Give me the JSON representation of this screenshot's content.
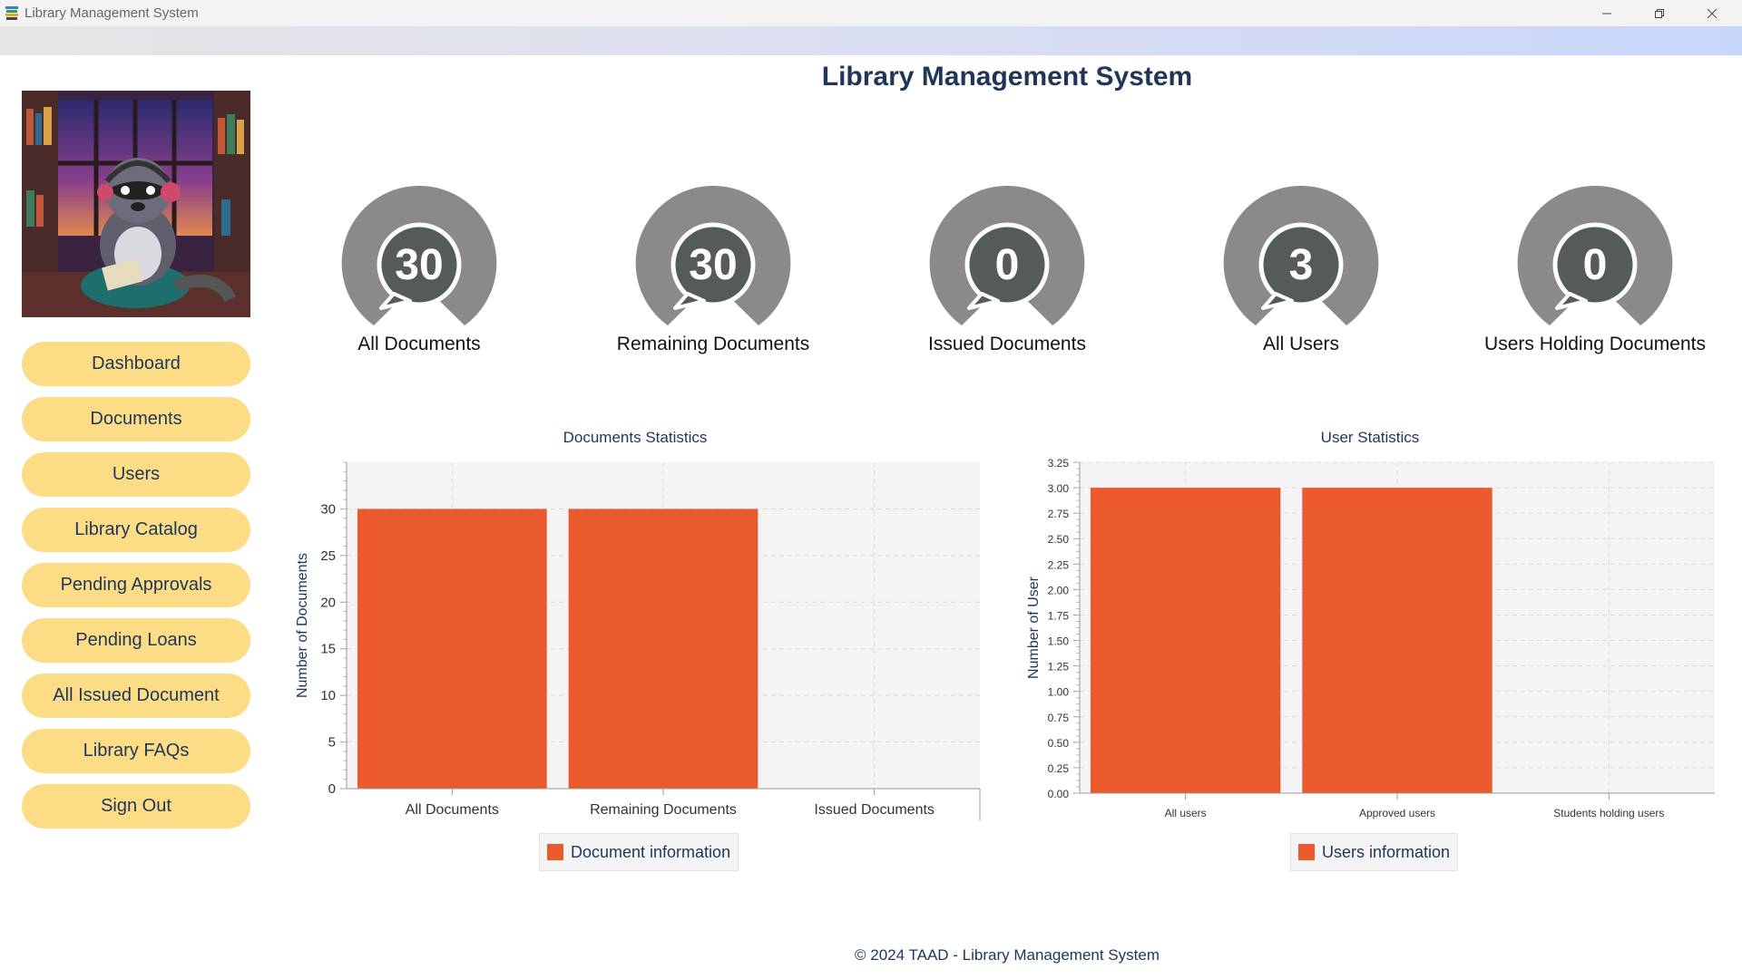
{
  "window": {
    "title": "Library Management System"
  },
  "header": {
    "title": "Library Management System"
  },
  "sidebar": {
    "items": [
      {
        "label": "Dashboard"
      },
      {
        "label": "Documents"
      },
      {
        "label": "Users"
      },
      {
        "label": "Library Catalog"
      },
      {
        "label": "Pending Approvals"
      },
      {
        "label": "Pending Loans"
      },
      {
        "label": "All Issued Document"
      },
      {
        "label": "Library FAQs"
      },
      {
        "label": "Sign Out"
      }
    ]
  },
  "stats": [
    {
      "value": "30",
      "label": "All Documents"
    },
    {
      "value": "30",
      "label": "Remaining Documents"
    },
    {
      "value": "0",
      "label": "Issued Documents"
    },
    {
      "value": "3",
      "label": "All Users"
    },
    {
      "value": "0",
      "label": "Users Holding Documents"
    }
  ],
  "colors": {
    "accent": "#ea5a2c",
    "nav_button": "#fddc86",
    "text_dark": "#1f3658",
    "badge_outer": "#8a8a8a",
    "badge_inner": "#555b5a"
  },
  "chart_data": [
    {
      "type": "bar",
      "title": "Documents Statistics",
      "xlabel": "",
      "ylabel": "Number of  Documents",
      "categories": [
        "All Documents",
        "Remaining Documents",
        "Issued Documents"
      ],
      "series": [
        {
          "name": "Document information",
          "values": [
            30,
            30,
            0
          ]
        }
      ],
      "ylim": [
        0,
        35
      ],
      "yticks": [
        "0",
        "5",
        "10",
        "15",
        "20",
        "25",
        "30"
      ],
      "grid": true,
      "legend": "bottom"
    },
    {
      "type": "bar",
      "title": "User Statistics",
      "xlabel": "",
      "ylabel": "Number of User",
      "categories": [
        "All users",
        "Approved users",
        "Students holding users"
      ],
      "series": [
        {
          "name": "Users information",
          "values": [
            3,
            3,
            0
          ]
        }
      ],
      "ylim": [
        0,
        3.25
      ],
      "yticks": [
        "0.00",
        "0.25",
        "0.50",
        "0.75",
        "1.00",
        "1.25",
        "1.50",
        "1.75",
        "2.00",
        "2.25",
        "2.50",
        "2.75",
        "3.00",
        "3.25"
      ],
      "grid": true,
      "legend": "bottom"
    }
  ],
  "footer": {
    "text": "© 2024 TAAD - Library Management System"
  }
}
